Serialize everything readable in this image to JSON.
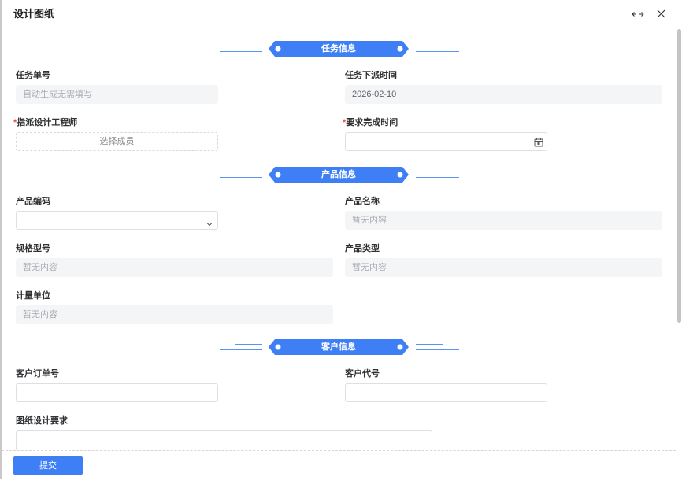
{
  "dialog": {
    "title": "设计图纸",
    "expand_icon": "expand-horizontal-icon",
    "close_icon": "close-icon"
  },
  "task_info": {
    "title": "任务信息",
    "task_no": {
      "label": "任务单号",
      "placeholder": "自动生成无需填写",
      "disabled": true
    },
    "dispatch_time": {
      "label": "任务下派时间",
      "value": "2026-02-10",
      "disabled": true
    },
    "designer": {
      "required_mark": "*",
      "label": "指派设计工程师",
      "button_label": "选择成员"
    },
    "due_time": {
      "required_mark": "*",
      "label": "要求完成时间",
      "value": "",
      "icon": "calendar-icon"
    }
  },
  "product_info": {
    "title": "产品信息",
    "product_code": {
      "label": "产品编码",
      "value": "",
      "icon": "chevron-down-icon"
    },
    "product_name": {
      "label": "产品名称",
      "placeholder": "暂无内容",
      "disabled": true
    },
    "spec_model": {
      "label": "规格型号",
      "placeholder": "暂无内容",
      "disabled": true
    },
    "product_type": {
      "label": "产品类型",
      "placeholder": "暂无内容",
      "disabled": true
    },
    "unit": {
      "label": "计量单位",
      "placeholder": "暂无内容",
      "disabled": true
    }
  },
  "customer_info": {
    "title": "客户信息",
    "order_no": {
      "label": "客户订单号",
      "value": ""
    },
    "customer_code": {
      "label": "客户代号",
      "value": ""
    },
    "drawing_requirements": {
      "label": "图纸设计要求",
      "value": ""
    }
  },
  "footer": {
    "submit_label": "提交"
  },
  "colors": {
    "primary": "#3f7ff5",
    "required": "#f04b4b",
    "disabled_bg": "#f4f5f7",
    "border": "#dcdfe6",
    "label": "#303133",
    "placeholder": "#a8abb2"
  }
}
